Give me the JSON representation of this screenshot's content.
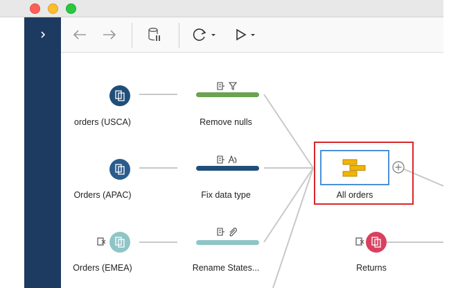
{
  "window": {
    "traffic_lights": [
      "close",
      "minimize",
      "zoom"
    ]
  },
  "sidebar": {
    "toggle_icon": "chevron-right-icon",
    "color": "#1d3b61"
  },
  "toolbar": {
    "buttons": [
      "back-arrow-icon",
      "forward-arrow-icon",
      "pause-data-updates-icon",
      "refresh-icon",
      "run-flow-icon"
    ]
  },
  "flow": {
    "inputs": [
      {
        "label": "orders (USCA)",
        "color": "#1f4e79",
        "icon": "input-files-icon"
      },
      {
        "label": "Orders (APAC)",
        "color": "#2a5c8c",
        "icon": "input-files-icon"
      },
      {
        "label": "Orders (EMEA)",
        "color": "#8fc5c7",
        "icon": "input-files-icon",
        "warning_icon": "excluded-icon"
      }
    ],
    "cleans": [
      {
        "label": "Remove nulls",
        "color": "#6ba34f",
        "icons": [
          "fields-icon",
          "filter-icon"
        ]
      },
      {
        "label": "Fix data type",
        "color": "#1f4e79",
        "icons": [
          "fields-icon",
          "type-change-icon"
        ]
      },
      {
        "label": "Rename States...",
        "color": "#8fc5c7",
        "icons": [
          "fields-icon",
          "paperclip-icon"
        ]
      }
    ],
    "union": {
      "label": "All orders",
      "icon": "union-icon",
      "color": "#f4b400",
      "add_icon": "plus-circle-icon"
    },
    "returns": {
      "label": "Returns",
      "color": "#d94060",
      "icon": "input-files-icon",
      "warning_icon": "excluded-icon"
    }
  }
}
